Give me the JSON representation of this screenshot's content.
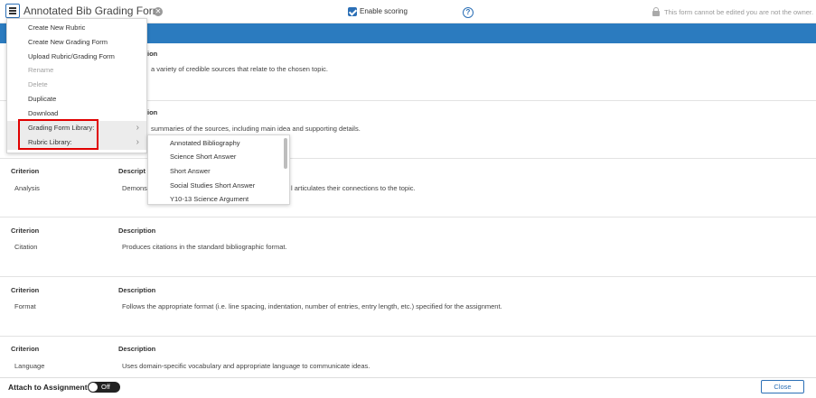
{
  "header": {
    "title": "Annotated Bib Grading Form",
    "enable_scoring_label": "Enable scoring",
    "enable_scoring_checked": true,
    "readonly_note": "This form cannot be edited you are not the owner.",
    "help_icon": "question-circle-icon",
    "lock_icon": "lock-icon",
    "menu_icon": "hamburger-icon"
  },
  "partial_rows": {
    "row1_header_tail": "ion",
    "row1_desc_tail": "a variety of credible sources that relate to the chosen topic.",
    "row2_header_tail": "ion",
    "row2_desc_tail": "summaries of the sources, including main idea and supporting details."
  },
  "rows": [
    {
      "crit_header": "Criterion",
      "desc_header": "Descript",
      "criterion": "Analysis",
      "description_left": "Demonst",
      "description_right": "l articulates their connections to the topic."
    },
    {
      "crit_header": "Criterion",
      "desc_header": "Description",
      "criterion": "Citation",
      "description": "Produces citations in the standard bibliographic format."
    },
    {
      "crit_header": "Criterion",
      "desc_header": "Description",
      "criterion": "Format",
      "description": "Follows the appropriate format (i.e. line spacing, indentation, number of entries, entry length, etc.) specified for the assignment."
    },
    {
      "crit_header": "Criterion",
      "desc_header": "Description",
      "criterion": "Language",
      "description": "Uses domain-specific vocabulary and appropriate language to communicate ideas."
    }
  ],
  "menu": {
    "items": [
      {
        "label": "Create New Rubric",
        "disabled": false
      },
      {
        "label": "Create New Grading Form",
        "disabled": false
      },
      {
        "label": "Upload Rubric/Grading Form",
        "disabled": false
      },
      {
        "label": "Rename",
        "disabled": true
      },
      {
        "label": "Delete",
        "disabled": true
      },
      {
        "label": "Duplicate",
        "disabled": false
      },
      {
        "label": "Download",
        "disabled": false
      },
      {
        "label": "Grading Form Library:",
        "disabled": false,
        "submenu": true
      },
      {
        "label": "Rubric Library:",
        "disabled": false,
        "submenu": true
      }
    ],
    "chevron": "›"
  },
  "submenu": {
    "items": [
      "Annotated Bibliography",
      "Science Short Answer",
      "Short Answer",
      "Social Studies Short Answer",
      "Y10-13 Science Argument"
    ]
  },
  "footer": {
    "attach_label": "Attach to Assignment",
    "toggle_label": "Off",
    "close_label": "Close"
  },
  "colors": {
    "accent": "#2b7bbf",
    "highlight": "#e00000"
  }
}
